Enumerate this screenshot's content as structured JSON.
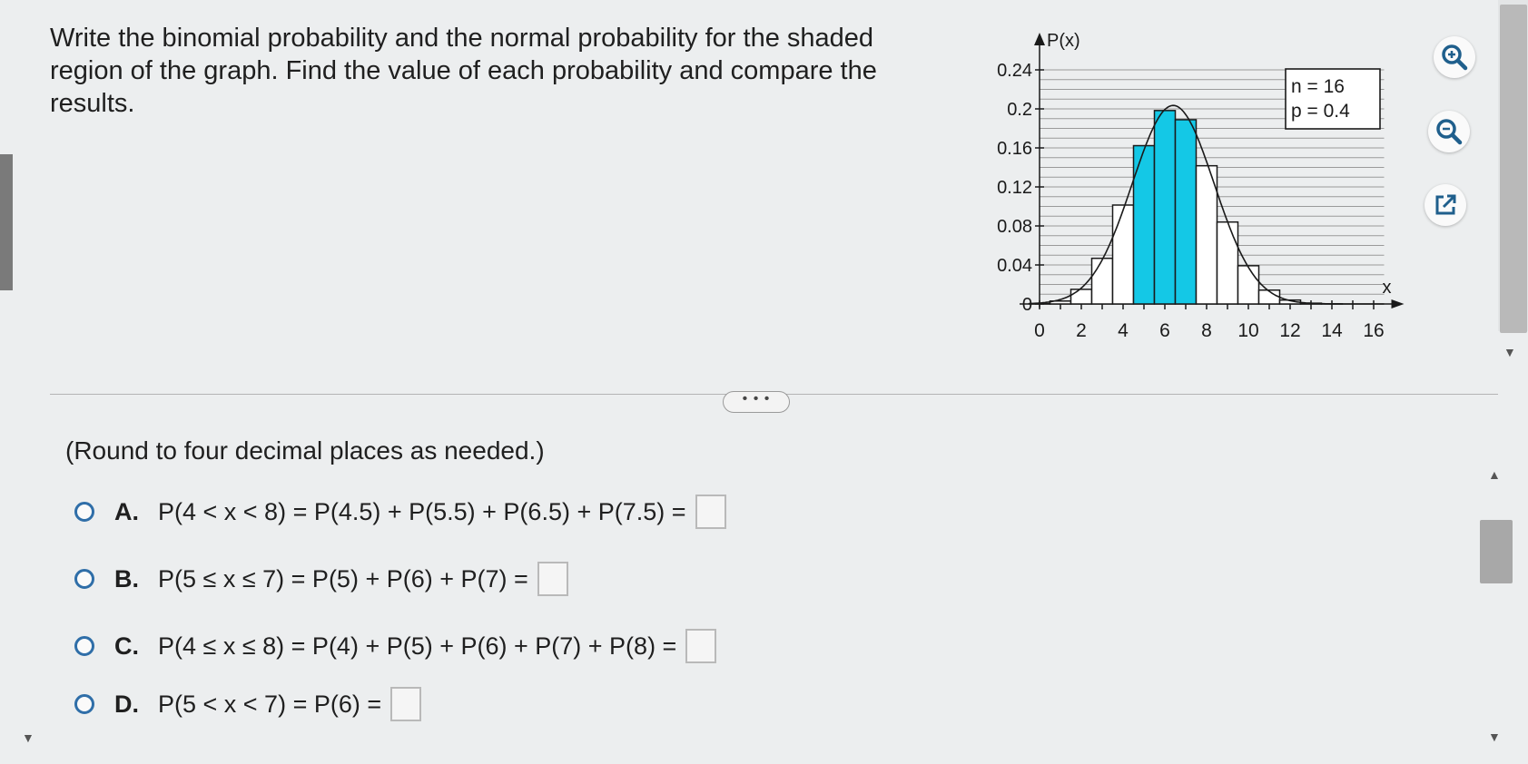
{
  "question": {
    "text": "Write the binomial probability and the normal probability for the shaded region of the graph. Find the value of each probability and compare the results."
  },
  "chart_data": {
    "type": "bar",
    "ylabel": "P(x)",
    "xlabel": "x",
    "legend": [
      "n = 16",
      "p = 0.4"
    ],
    "x_ticks": [
      "0",
      "2",
      "4",
      "6",
      "8",
      "10",
      "12",
      "14",
      "16"
    ],
    "y_ticks": [
      "0",
      "0.04",
      "0.08",
      "0.12",
      "0.16",
      "0.2",
      "0.24"
    ],
    "xlim": [
      0,
      16
    ],
    "ylim": [
      0,
      0.24
    ],
    "x": [
      0,
      1,
      2,
      3,
      4,
      5,
      6,
      7,
      8,
      9,
      10,
      11,
      12,
      13,
      14,
      15,
      16
    ],
    "values": [
      0.0003,
      0.003,
      0.015,
      0.0468,
      0.1014,
      0.1623,
      0.1983,
      0.1889,
      0.1417,
      0.084,
      0.0392,
      0.0142,
      0.004,
      0.0008,
      0.0001,
      0.0,
      0.0
    ],
    "shaded": [
      5,
      6,
      7
    ],
    "normal_curve": {
      "mean": 6.4,
      "sd": 1.96
    },
    "colors": {
      "shaded": "#14c8e6",
      "bars": "#ffffff",
      "stroke": "#1a1a1a"
    },
    "grid": true
  },
  "tools": {
    "zoom_in_icon": "zoom-in-icon",
    "zoom_out_icon": "zoom-out-icon",
    "popout_icon": "external-link-icon",
    "accent": "#1f5f8c"
  },
  "more_label": "• • •",
  "instructions": "(Round to four decimal places as needed.)",
  "options": [
    {
      "letter": "A.",
      "expr": "P(4 < x < 8) = P(4.5) + P(5.5) + P(6.5) + P(7.5) ="
    },
    {
      "letter": "B.",
      "expr": "P(5 ≤ x ≤ 7) = P(5) + P(6) + P(7) ="
    },
    {
      "letter": "C.",
      "expr": "P(4 ≤ x ≤ 8) = P(4) + P(5) + P(6) + P(7) + P(8) ="
    },
    {
      "letter": "D.",
      "expr": "P(5 < x < 7) = P(6) ="
    }
  ]
}
